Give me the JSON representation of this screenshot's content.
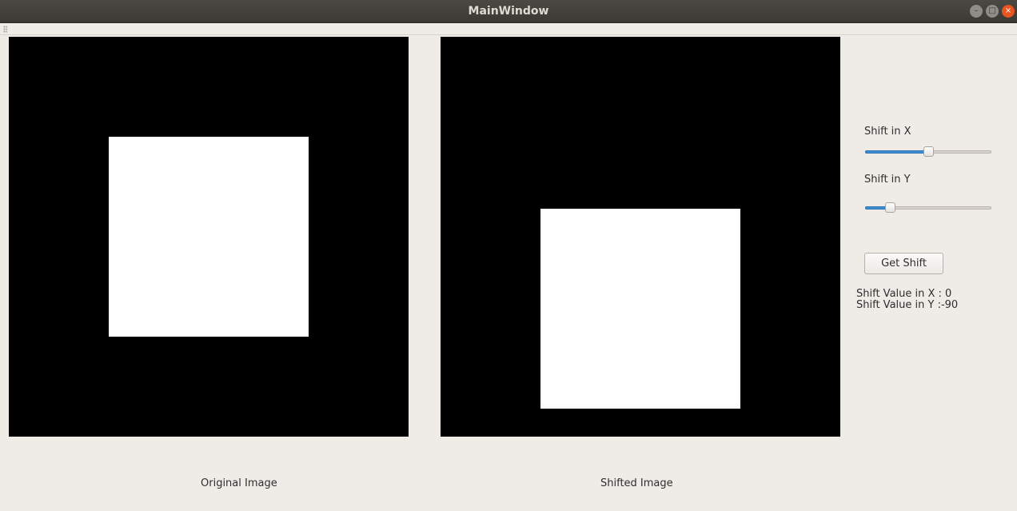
{
  "window": {
    "title": "MainWindow",
    "controls": {
      "minimize": "–",
      "maximize": "□",
      "close": "×"
    }
  },
  "images": {
    "original_caption": "Original Image",
    "shifted_caption": "Shifted Image"
  },
  "controls": {
    "shift_x_label": "Shift in X",
    "shift_x_level": 0.5,
    "shift_y_label": "Shift in Y",
    "shift_y_level": 0.17,
    "get_shift_button": "Get Shift",
    "result_x": "Shift Value in X : 0",
    "result_y": "Shift Value in Y :-90"
  },
  "colors": {
    "accent": "#3d8ed4",
    "close_button": "#e95420",
    "image_background": "#000000",
    "square": "#ffffff"
  }
}
